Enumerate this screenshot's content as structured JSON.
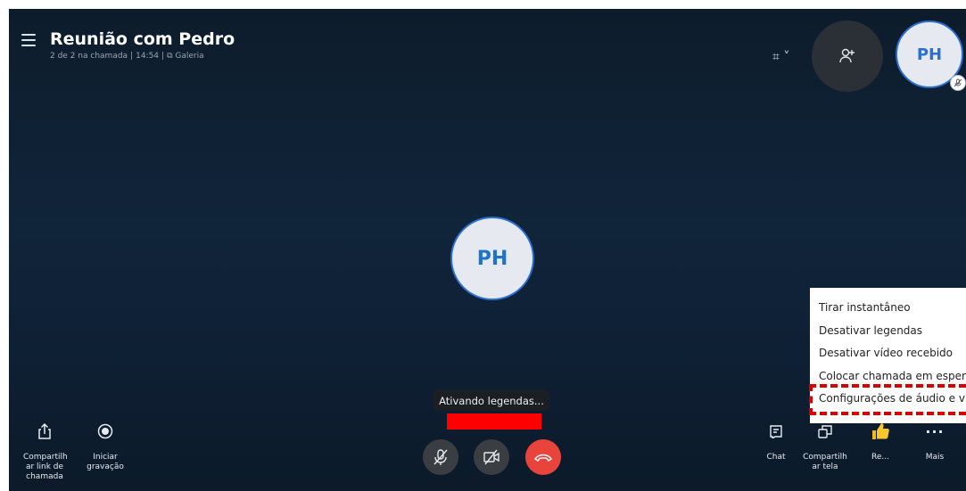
{
  "header": {
    "title": "Reunião com Pedro",
    "participants": "2 de 2 na chamada",
    "duration": "14:54",
    "view_mode": "Galeria"
  },
  "participant_initials_top": "PH",
  "participant_initials_center": "PH",
  "caption_toast": "Ativando legendas...",
  "context_menu": {
    "items": [
      "Tirar instantâneo",
      "Desativar legendas",
      "Desativar vídeo recebido",
      "Colocar chamada em espera",
      "Configurações de áudio e vídeo"
    ]
  },
  "toolbar_left": {
    "share_link_label": "Compartilh ar link de chamada",
    "record_label": "Iniciar gravação"
  },
  "toolbar_right": {
    "chat_label": "Chat",
    "share_screen_label": "Compartilh ar tela",
    "react_label": "Re...",
    "more_label": "Mais"
  },
  "colors": {
    "accent": "#2b6fd0",
    "end_call": "#e8443c",
    "highlight": "#d90000"
  }
}
